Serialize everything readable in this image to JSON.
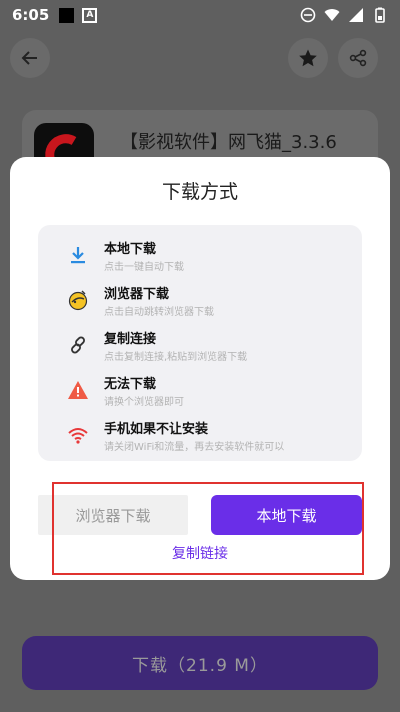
{
  "status": {
    "time": "6:05"
  },
  "app": {
    "title": "【影视软件】网飞猫_3.3.6"
  },
  "download_bar": {
    "label": "下载（21.9 M）"
  },
  "dialog": {
    "title": "下载方式",
    "options": [
      {
        "title": "本地下载",
        "subtitle": "点击一键自动下载",
        "icon": "download-icon"
      },
      {
        "title": "浏览器下载",
        "subtitle": "点击自动跳转浏览器下载",
        "icon": "browser-icon"
      },
      {
        "title": "复制连接",
        "subtitle": "点击复制连接,粘贴到浏览器下载",
        "icon": "link-icon"
      },
      {
        "title": "无法下载",
        "subtitle": "请换个浏览器即可",
        "icon": "warning-icon"
      },
      {
        "title": "手机如果不让安装",
        "subtitle": "请关闭WiFi和流量，再去安装软件就可以",
        "icon": "wifi-icon"
      }
    ],
    "browser_button": "浏览器下载",
    "local_button": "本地下载",
    "copy_link": "复制链接"
  },
  "colors": {
    "accent": "#6a2ee8",
    "highlight": "#e0322f"
  }
}
